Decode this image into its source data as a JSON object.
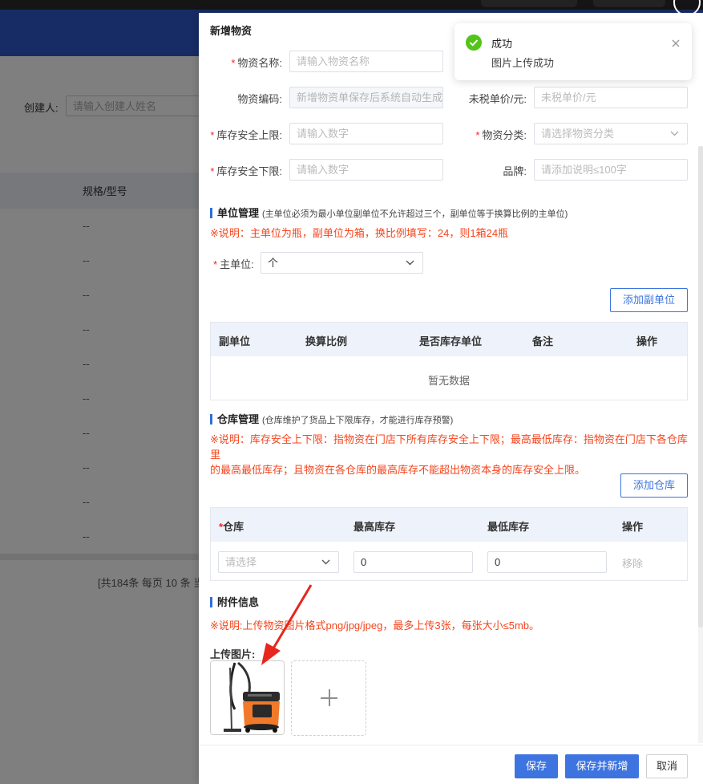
{
  "background": {
    "filter_label": "创建人:",
    "filter_placeholder": "请输入创建人姓名",
    "column_header": "规格/型号",
    "rows": [
      "--",
      "--",
      "--",
      "--",
      "--",
      "--",
      "--",
      "--",
      "--",
      "--"
    ],
    "pagination": "[共184条 每页 10 条 当"
  },
  "drawer": {
    "title": "新增物资",
    "fields": {
      "name": {
        "label": "物资名称:",
        "placeholder": "请输入物资名称",
        "required": "*"
      },
      "code": {
        "label": "物资编码:",
        "placeholder": "新增物资单保存后系统自动生成"
      },
      "untaxed_price": {
        "label": "未税单价/元:",
        "placeholder": "未税单价/元"
      },
      "stock_upper": {
        "label": "库存安全上限:",
        "placeholder": "请输入数字",
        "required": "*"
      },
      "category": {
        "label": "物资分类:",
        "placeholder": "请选择物资分类",
        "required": "*"
      },
      "stock_lower": {
        "label": "库存安全下限:",
        "placeholder": "请输入数字",
        "required": "*"
      },
      "brand": {
        "label": "品牌:",
        "placeholder": "请添加说明≤100字"
      }
    },
    "unit_section": {
      "title": "单位管理",
      "note": "(主单位必须为最小单位副单位不允许超过三个，副单位等于换算比例的主单位)",
      "red_note": "※说明：主单位为瓶，副单位为箱，换比例填写：24，则1箱24瓶",
      "main_unit_label": "主单位:",
      "main_unit_required": "*",
      "main_unit_value": "个",
      "add_button": "添加副单位",
      "columns": [
        "副单位",
        "换算比例",
        "是否库存单位",
        "备注",
        "操作"
      ],
      "empty_text": "暂无数据"
    },
    "warehouse_section": {
      "title": "仓库管理",
      "note": "(仓库维护了货品上下限库存，才能进行库存预警)",
      "red_note_line1": "※说明：库存安全上下限：指物资在门店下所有库存安全上下限；最高最低库存：指物资在门店下各仓库里",
      "red_note_line2": "的最高最低库存；且物资在各仓库的最高库存不能超出物资本身的库存安全上限。",
      "add_button": "添加仓库",
      "col_warehouse_star": "*",
      "columns": [
        "仓库",
        "最高库存",
        "最低库存",
        "操作"
      ],
      "row": {
        "warehouse_placeholder": "请选择",
        "max_value": "0",
        "min_value": "0",
        "remove": "移除"
      }
    },
    "attachment_section": {
      "title": "附件信息",
      "red_note": "※说明:上传物资图片格式png/jpg/jpeg，最多上传3张，每张大小≤5mb。",
      "upload_label": "上传图片:"
    },
    "footer": {
      "save": "保存",
      "save_and_new": "保存并新增",
      "cancel": "取消"
    }
  },
  "toast": {
    "title": "成功",
    "message": "图片上传成功",
    "color": "#52c41a"
  },
  "colors": {
    "primary": "#3d74e0",
    "header": "#2f59c8",
    "warning_text": "#f5451d"
  }
}
